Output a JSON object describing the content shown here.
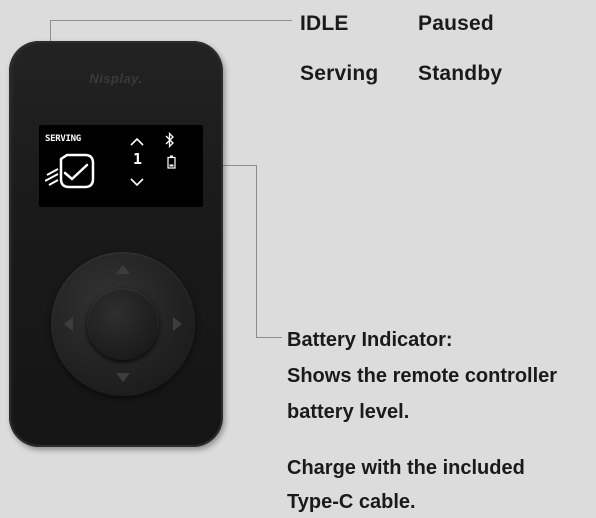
{
  "status_states": {
    "idle": "IDLE",
    "paused": "Paused",
    "serving": "Serving",
    "standby": "Standby"
  },
  "device": {
    "brand": "Nisplay.",
    "screen": {
      "status": "SERVING",
      "table_number": "1"
    }
  },
  "battery_annotation": {
    "title": "Battery Indicator:",
    "description_line1": "Shows the remote controller",
    "description_line2": "battery level.",
    "charge_line1": "Charge with the included",
    "charge_line2": "Type-C cable."
  },
  "colors": {
    "background": "#dcdcdc",
    "device_body": "#1a1a1a",
    "screen": "#000000",
    "callout_line": "#8f8f8f"
  },
  "icons": [
    "bluetooth-icon",
    "battery-icon",
    "robot-face-icon",
    "chevron-up-icon",
    "chevron-down-icon",
    "dpad-arrow-icons"
  ]
}
